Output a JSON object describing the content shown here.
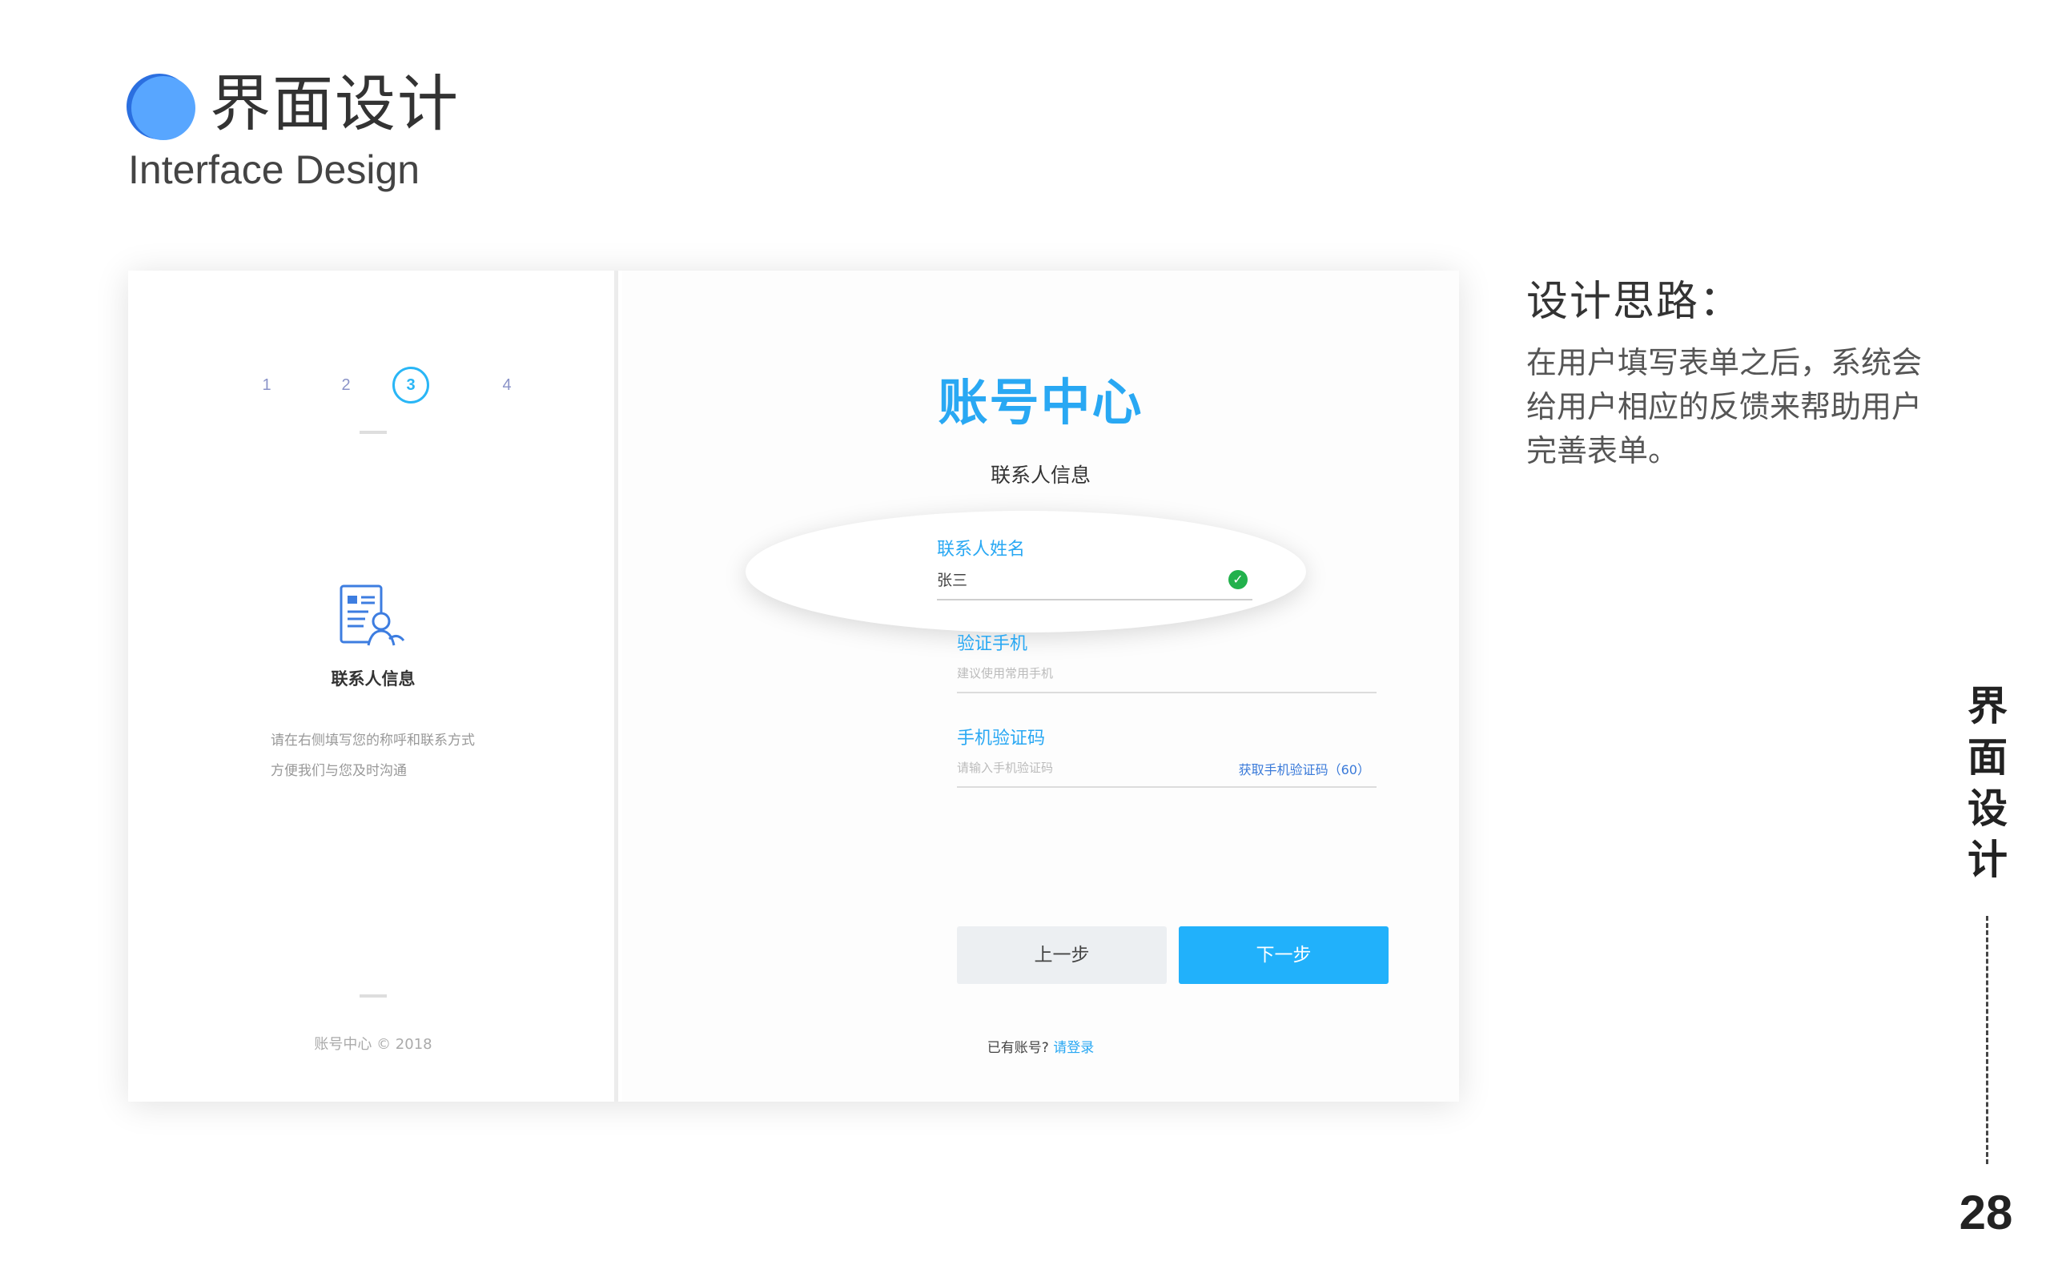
{
  "header": {
    "title": "界面设计",
    "subtitle": "Interface Design"
  },
  "mockup": {
    "left": {
      "steps": [
        "1",
        "2",
        "3",
        "4"
      ],
      "active_step": 3,
      "section_title": "联系人信息",
      "desc_line1": "请在右侧填写您的称呼和联系方式",
      "desc_line2": "方便我们与您及时沟通",
      "copyright": "账号中心 © 2018"
    },
    "right": {
      "logo": "账号中心",
      "form_title": "联系人信息",
      "fields": {
        "name": {
          "label": "联系人姓名",
          "value": "张三"
        },
        "phone": {
          "label": "验证手机",
          "placeholder": "建议使用常用手机"
        },
        "code": {
          "label": "手机验证码",
          "placeholder": "请输入手机验证码",
          "action": "获取手机验证码（60）"
        }
      },
      "buttons": {
        "prev": "上一步",
        "next": "下一步"
      },
      "login_prompt": "已有账号?",
      "login_link": "请登录"
    }
  },
  "side": {
    "title": "设计思路：",
    "body": "在用户填写表单之后，系统会给用户相应的反馈来帮助用户完善表单。"
  },
  "section_label": [
    "界",
    "面",
    "设",
    "计"
  ],
  "page_number": "28",
  "colors": {
    "accent": "#29a8f3",
    "primary_button": "#21b1fb",
    "success": "#22b14c",
    "header_circle": "#58a6ff"
  }
}
